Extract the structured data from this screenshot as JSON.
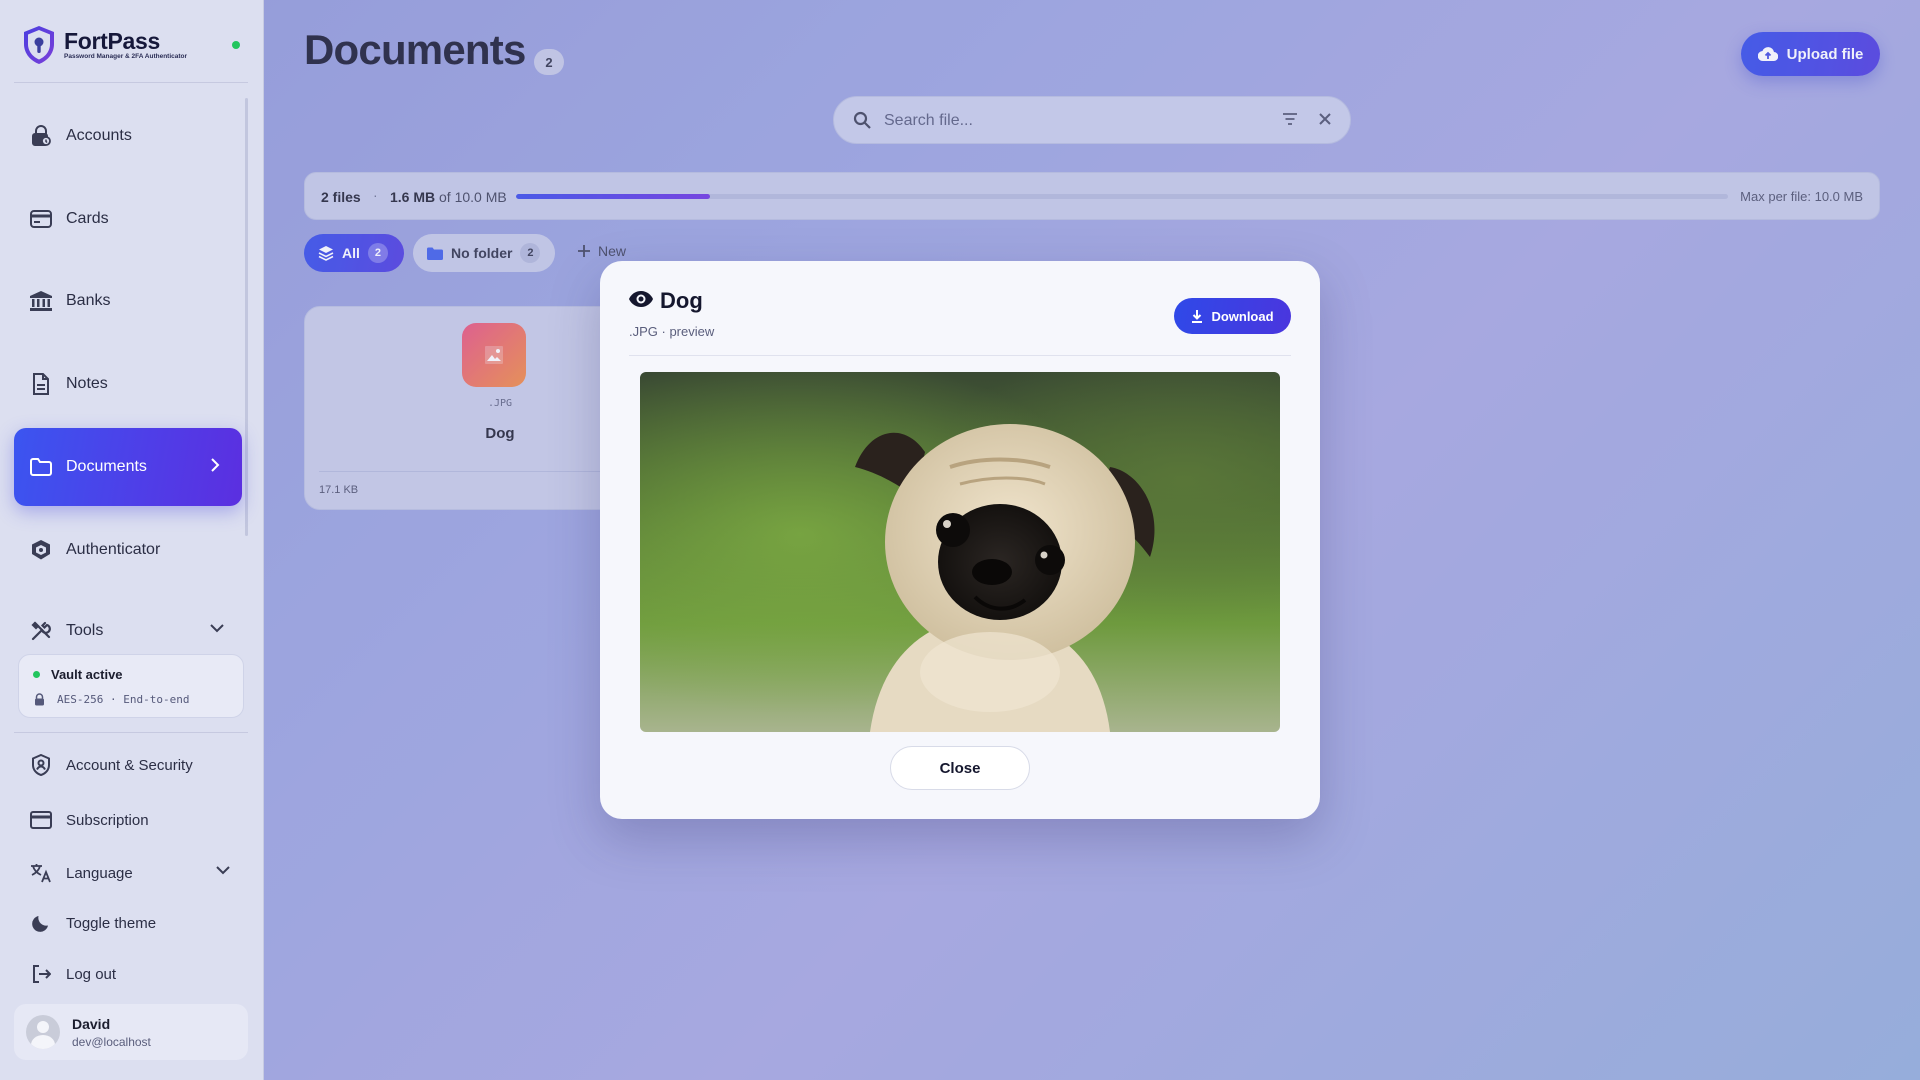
{
  "brand": {
    "name": "FortPass",
    "tagline": "Password Manager & 2FA Authenticator"
  },
  "sidebar": {
    "nav": [
      {
        "label": "Accounts",
        "icon": "lock-icon"
      },
      {
        "label": "Cards",
        "icon": "card-icon"
      },
      {
        "label": "Banks",
        "icon": "bank-icon"
      },
      {
        "label": "Notes",
        "icon": "note-icon"
      },
      {
        "label": "Documents",
        "icon": "folder-icon",
        "active": true
      },
      {
        "label": "Authenticator",
        "icon": "shield-cube-icon"
      },
      {
        "label": "Tools",
        "icon": "tools-icon"
      }
    ],
    "vault": {
      "title": "Vault active",
      "subtitle": "AES-256 · End-to-end"
    },
    "utilities": [
      {
        "label": "Account & Security",
        "icon": "shield-user-icon"
      },
      {
        "label": "Subscription",
        "icon": "credit-card-icon"
      },
      {
        "label": "Language",
        "icon": "translate-icon"
      },
      {
        "label": "Toggle theme",
        "icon": "moon-icon"
      },
      {
        "label": "Log out",
        "icon": "logout-icon"
      }
    ],
    "user": {
      "name": "David",
      "email": "dev@localhost"
    }
  },
  "header": {
    "title": "Documents",
    "count": "2",
    "upload_label": "Upload file"
  },
  "search": {
    "placeholder": "Search file..."
  },
  "storage": {
    "files": "2 files",
    "separator": "·",
    "used": "1.6 MB",
    "of_total": "of 10.0 MB",
    "used_fraction": 0.16,
    "max_per_file": "Max per file: 10.0 MB"
  },
  "filters": {
    "all_label": "All",
    "all_count": "2",
    "nofolder_label": "No folder",
    "nofolder_count": "2",
    "new_label": "New"
  },
  "files": [
    {
      "ext": ".JPG",
      "name": "Dog",
      "size": "17.1 KB"
    }
  ],
  "modal": {
    "title": "Dog",
    "subtitle": ".JPG · preview",
    "download_label": "Download",
    "close_label": "Close"
  },
  "colors": {
    "accent": "#3b4ae8",
    "accent_end": "#5b2fe0",
    "status_ok": "#22c55e",
    "file_icon_start": "#e94f7d",
    "file_icon_end": "#f28a3c"
  }
}
